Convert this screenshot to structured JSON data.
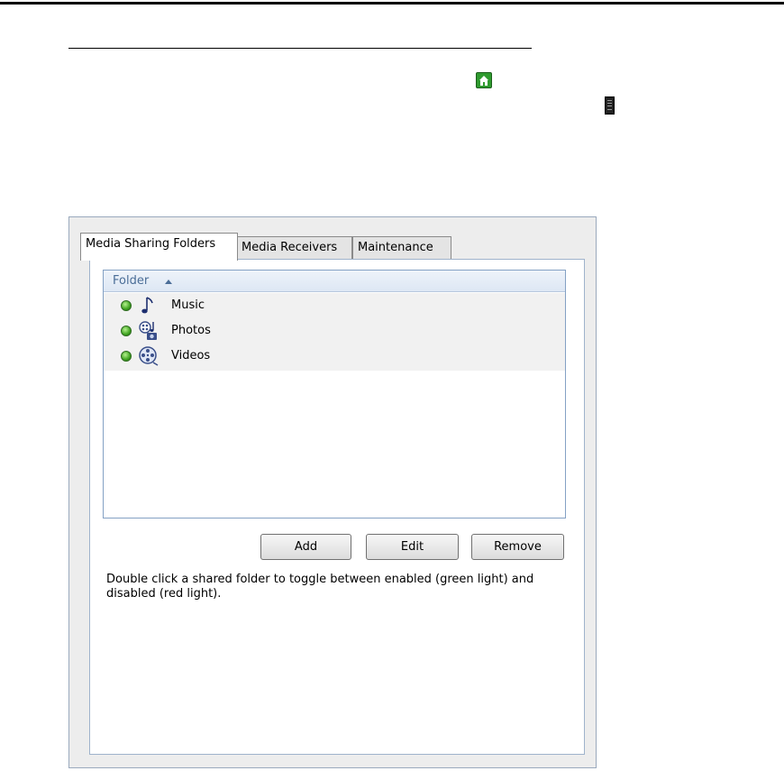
{
  "page": {
    "icons": {
      "home": "home-network-icon",
      "server": "server-tower-icon"
    }
  },
  "dialog": {
    "tabs": [
      {
        "label": "Media Sharing Folders",
        "active": true
      },
      {
        "label": "Media Receivers",
        "active": false
      },
      {
        "label": "Maintenance",
        "active": false
      }
    ],
    "list": {
      "column_header": "Folder",
      "sort": "ascending",
      "rows": [
        {
          "name": "Music",
          "status": "enabled",
          "status_color": "#3ea31f",
          "icon": "music-note-icon"
        },
        {
          "name": "Photos",
          "status": "enabled",
          "status_color": "#3ea31f",
          "icon": "photos-icon"
        },
        {
          "name": "Videos",
          "status": "enabled",
          "status_color": "#3ea31f",
          "icon": "film-reel-icon"
        }
      ]
    },
    "buttons": {
      "add": "Add",
      "edit": "Edit",
      "remove": "Remove"
    },
    "hint": "Double click a shared folder to toggle between enabled (green light) and disabled (red light)."
  }
}
